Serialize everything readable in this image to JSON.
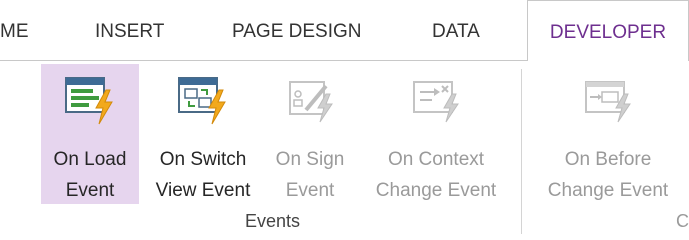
{
  "tabs": [
    {
      "label": "ME"
    },
    {
      "label": "INSERT"
    },
    {
      "label": "PAGE DESIGN"
    },
    {
      "label": "DATA"
    },
    {
      "label": "DEVELOPER"
    }
  ],
  "colors": {
    "accent": "#6e2f8f",
    "hover_bg": "#e6d5ee",
    "disabled_text": "#9a9a9a"
  },
  "events_group": {
    "label": "Events",
    "buttons": [
      {
        "line1": "On Load",
        "line2": "Event",
        "icon": "on-load-event-icon",
        "enabled": true,
        "hover": true
      },
      {
        "line1": "On Switch",
        "line2": "View Event",
        "icon": "on-switch-view-event-icon",
        "enabled": true
      },
      {
        "line1": "On Sign",
        "line2": "Event",
        "icon": "on-sign-event-icon",
        "enabled": false
      },
      {
        "line1": "On Context",
        "line2": "Change Event",
        "icon": "on-context-change-event-icon",
        "enabled": false
      }
    ]
  },
  "next_group": {
    "label": "C",
    "buttons": [
      {
        "line1": "On Before",
        "line2": "Change Event",
        "icon": "on-before-change-event-icon",
        "enabled": false
      }
    ]
  }
}
